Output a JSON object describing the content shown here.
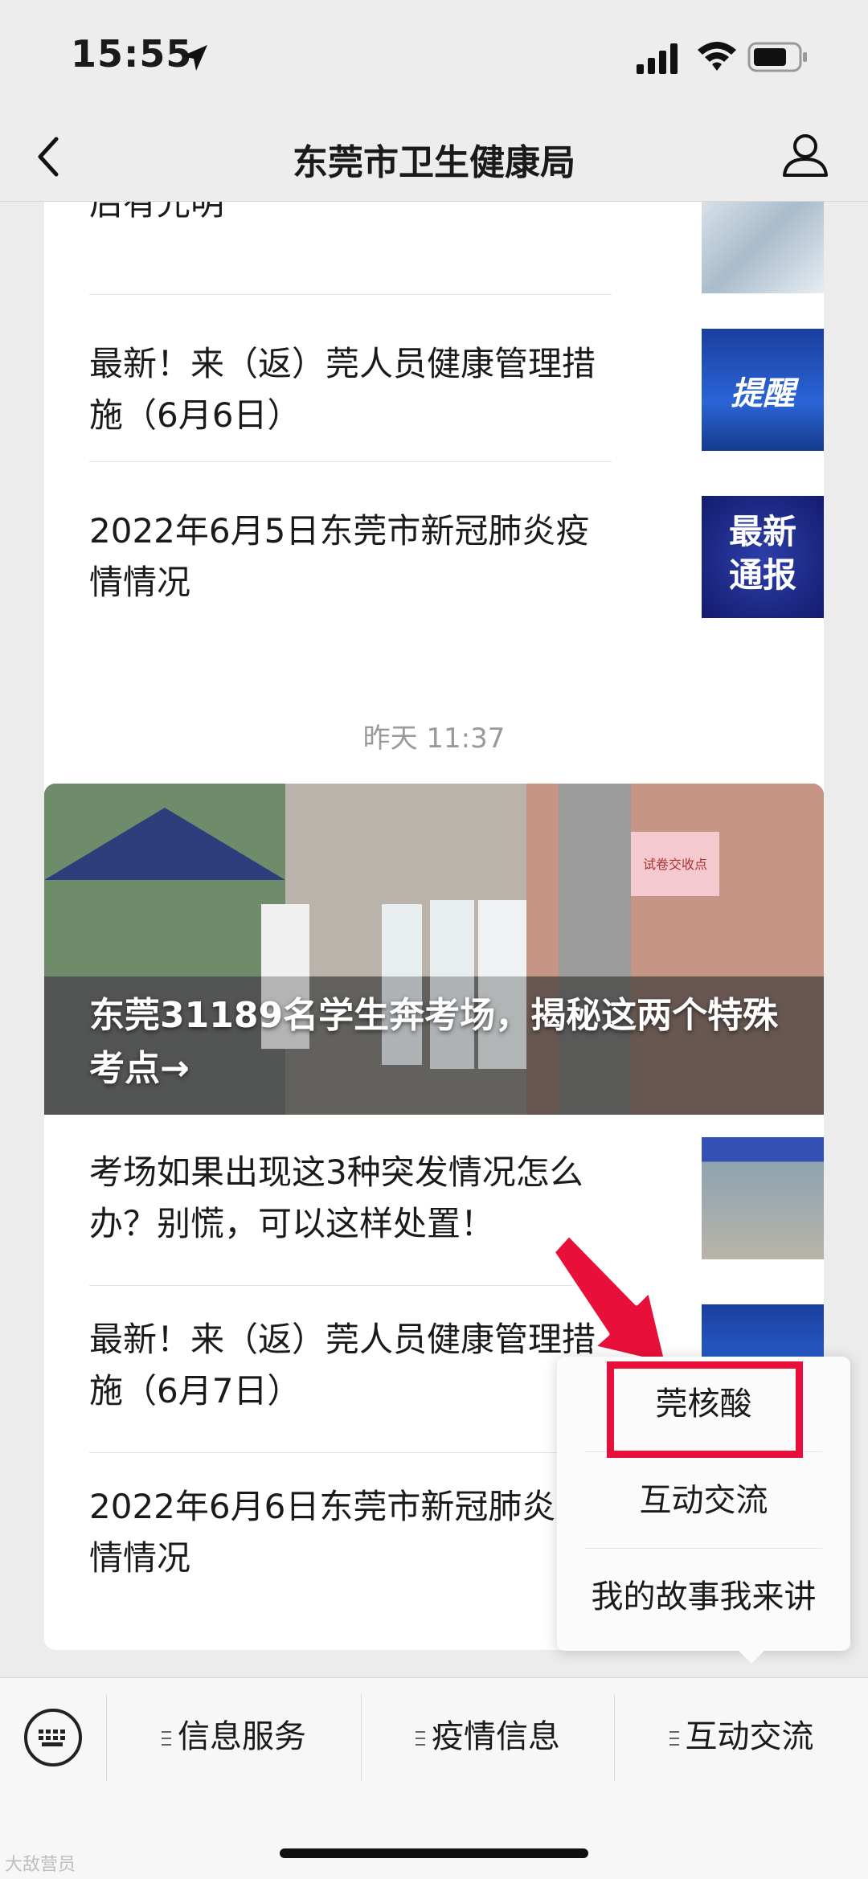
{
  "status_bar": {
    "time": "15:55"
  },
  "nav": {
    "title": "东莞市卫生健康局"
  },
  "top_card": {
    "partial_title": "后有光明",
    "articles": [
      {
        "title": "最新！来（返）莞人员健康管理措施（6月6日）",
        "thumb_text": "提醒"
      },
      {
        "title": "2022年6月5日东莞市新冠肺炎疫情情况",
        "thumb_text": "最新\n通报"
      }
    ]
  },
  "date_label": "昨天 11:37",
  "bottom_card": {
    "hero_title": "东莞31189名学生奔考场，揭秘这两个特殊考点→",
    "hero_sign": "试卷交收点",
    "articles": [
      {
        "title": "考场如果出现这3种突发情况怎么办？别慌，可以这样处置！"
      },
      {
        "title": "最新！来（返）莞人员健康管理措施（6月7日）"
      },
      {
        "title": "2022年6月6日东莞市新冠肺炎疫情情况"
      }
    ]
  },
  "popup": {
    "items": [
      "莞核酸",
      "互动交流",
      "我的故事我来讲"
    ]
  },
  "bottom_menu": {
    "items": [
      "信息服务",
      "疫情信息",
      "互动交流"
    ]
  },
  "watermark": "大敌营员",
  "colors": {
    "highlight": "#e8103a",
    "accent_blue": "#1a3f9e"
  }
}
